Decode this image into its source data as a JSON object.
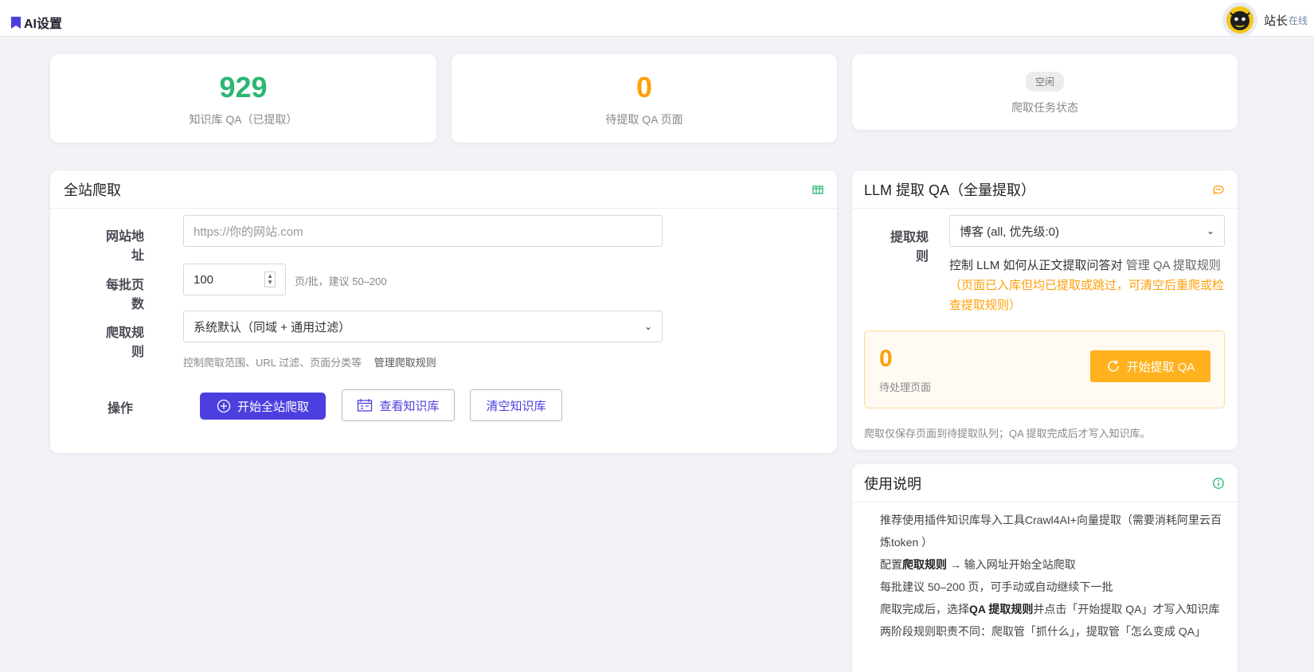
{
  "app": {
    "title": "AI设置",
    "user_name": "站长",
    "user_status": "在线"
  },
  "stats": {
    "qa_count": "929",
    "qa_label": "知识库 QA（已提取）",
    "pending_count": "0",
    "pending_label": "待提取 QA 页面",
    "task_badge": "空闲",
    "task_label": "爬取任务状态"
  },
  "crawl": {
    "title": "全站爬取",
    "url_label": "网站地址",
    "url_placeholder": "https://你的网站.com",
    "batch_label": "每批页数",
    "batch_value": "100",
    "batch_hint": "页/批，建议 50–200",
    "rule_label": "爬取规则",
    "rule_value": "系统默认（同域 + 通用过滤）",
    "rule_hint": "控制爬取范围、URL 过滤、页面分类等",
    "rule_manage_link": "管理爬取规则",
    "action_label": "操作",
    "btn_start": "开始全站爬取",
    "btn_view": "查看知识库",
    "btn_clear": "清空知识库"
  },
  "llm": {
    "title": "LLM 提取 QA（全量提取）",
    "rule_label": "提取规则",
    "rule_value": "博客 (all, 优先级:0)",
    "desc_text": "控制 LLM 如何从正文提取问答对",
    "desc_link": "管理 QA 提取规则",
    "warning": "（页面已入库但均已提取或跳过，可清空后重爬或检查提取规则）",
    "pending_num": "0",
    "pending_label": "待处理页面",
    "btn_extract": "开始提取 QA",
    "footer_note": "爬取仅保存页面到待提取队列；QA 提取完成后才写入知识库。"
  },
  "usage": {
    "title": "使用说明",
    "line1": "推荐使用插件知识库导入工具Crawl4AI+向量提取（需要消耗阿里云百炼token ）",
    "line2_pre": "配置",
    "line2_bold": "爬取规则",
    "line2_post": " → 输入网址开始全站爬取",
    "line3": "每批建议 50–200 页，可手动或自动继续下一批",
    "line4_pre": "爬取完成后，选择",
    "line4_bold": "QA 提取规则",
    "line4_post": "并点击「开始提取 QA」才写入知识库",
    "line5": "两阶段规则职责不同：爬取管「抓什么」，提取管「怎么变成 QA」"
  },
  "colors": {
    "primary": "#4c3fe0",
    "green": "#2bb673",
    "orange": "#ff9f0a",
    "button_orange": "#ffb21e"
  }
}
